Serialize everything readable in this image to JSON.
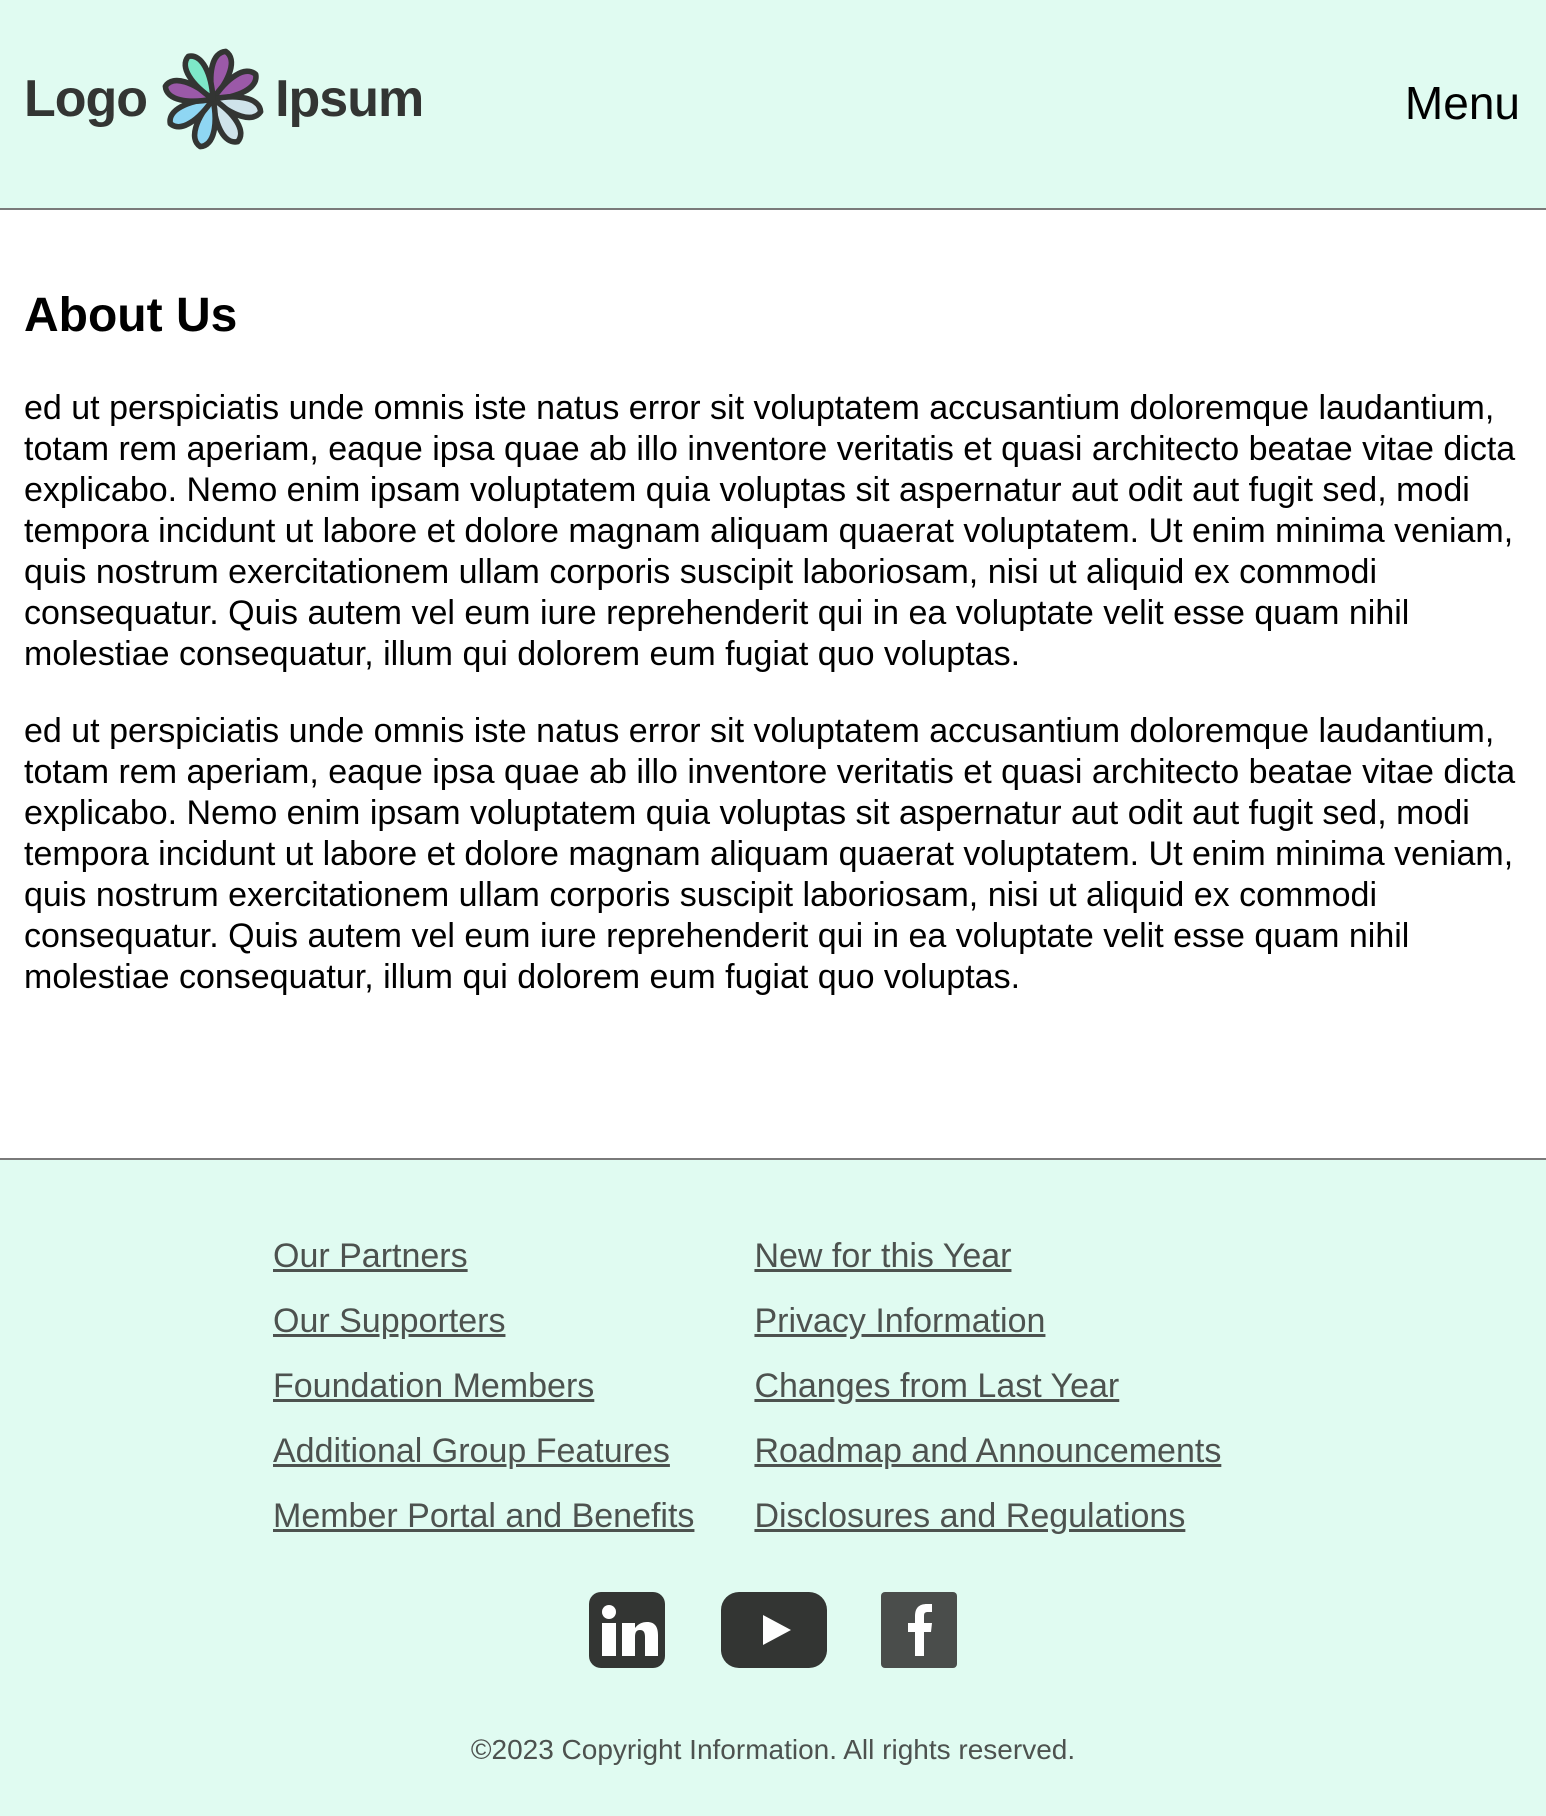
{
  "header": {
    "logo_left": "Logo",
    "logo_right": "Ipsum",
    "menu_label": "Menu"
  },
  "main": {
    "title": "About Us",
    "paragraphs": [
      "ed ut perspiciatis unde omnis iste natus error sit voluptatem accusantium doloremque laudantium, totam rem aperiam, eaque ipsa quae ab illo inventore veritatis et quasi architecto beatae vitae dicta explicabo. Nemo enim ipsam voluptatem quia voluptas sit aspernatur aut odit aut fugit sed, modi tempora incidunt ut labore et dolore magnam aliquam quaerat voluptatem. Ut enim minima veniam, quis nostrum exercitationem ullam corporis suscipit laboriosam, nisi ut aliquid ex commodi consequatur. Quis autem vel eum iure reprehenderit qui in ea voluptate velit esse quam nihil molestiae consequatur, illum qui dolorem eum fugiat quo voluptas.",
      "ed ut perspiciatis unde omnis iste natus error sit voluptatem accusantium doloremque laudantium, totam rem aperiam, eaque ipsa quae ab illo inventore veritatis et quasi architecto beatae vitae dicta explicabo. Nemo enim ipsam voluptatem quia voluptas sit aspernatur aut odit aut fugit sed, modi tempora incidunt ut labore et dolore magnam aliquam quaerat voluptatem. Ut enim minima veniam, quis nostrum exercitationem ullam corporis suscipit laboriosam, nisi ut aliquid ex commodi consequatur. Quis autem vel eum iure reprehenderit qui in ea voluptate velit esse quam nihil molestiae consequatur, illum qui dolorem eum fugiat quo voluptas."
    ]
  },
  "footer": {
    "links_left": [
      "Our Partners",
      "Our Supporters",
      "Foundation Members",
      "Additional Group Features",
      "Member Portal and Benefits"
    ],
    "links_right": [
      "New for this Year",
      "Privacy Information",
      "Changes from Last Year",
      "Roadmap and Announcements",
      "Disclosures and Regulations"
    ],
    "social": [
      {
        "icon": "linkedin-icon",
        "glyph": "in"
      },
      {
        "icon": "youtube-icon",
        "glyph": "play"
      },
      {
        "icon": "facebook-icon",
        "glyph": "f"
      }
    ],
    "copyright": "©2023 Copyright Information. All rights reserved."
  },
  "colors": {
    "header_bg": "#e0fbf1",
    "footer_bg": "#e0fbf1",
    "link_color": "#4d524f",
    "divider": "#7a7a7a",
    "icon_dark": "#333533",
    "logo_purple": "#9b59a8",
    "logo_teal": "#7ee8c8",
    "logo_blue": "#8fd6f3"
  }
}
